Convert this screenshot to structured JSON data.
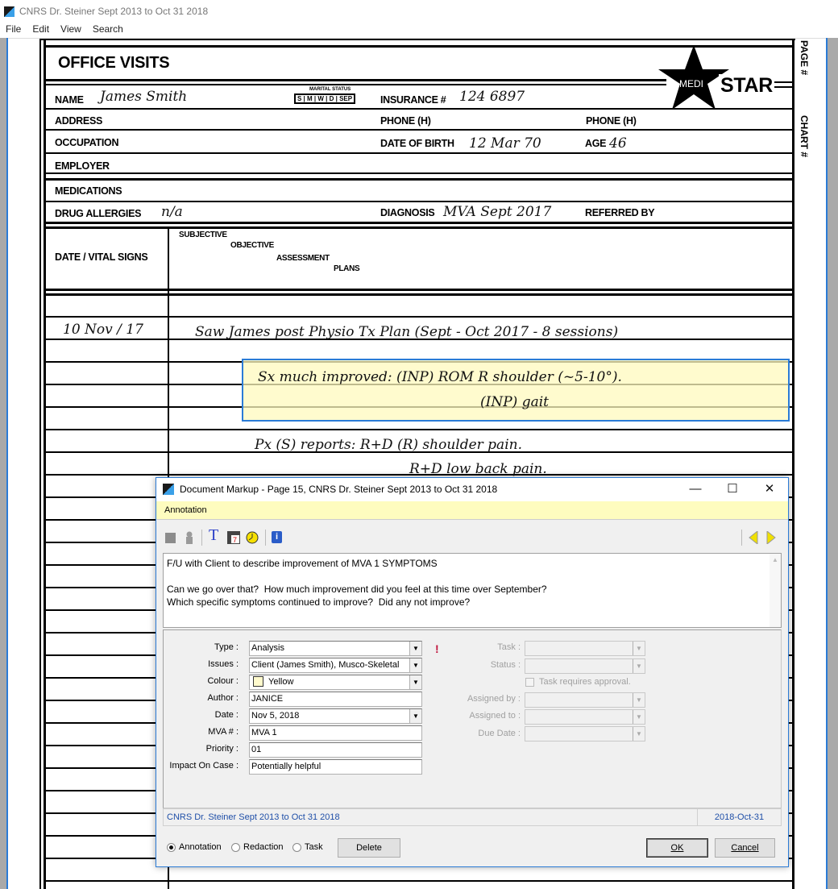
{
  "app": {
    "title": "CNRS Dr. Steiner Sept 2013 to Oct 31 2018",
    "menu": [
      "File",
      "Edit",
      "View",
      "Search"
    ]
  },
  "form": {
    "title": "OFFICE VISITS",
    "logo": "MEDI STAR",
    "logo_medi": "MEDI",
    "logo_star": "STAR",
    "side_labels": [
      "PAGE #",
      "CHART #"
    ],
    "labels": {
      "name": "NAME",
      "marital": "MARITAL STATUS",
      "marital_opts": "S | M | W | D | SEP",
      "insurance": "INSURANCE #",
      "address": "ADDRESS",
      "phone_h1": "PHONE (H)",
      "phone_h2": "PHONE (H)",
      "occupation": "OCCUPATION",
      "dob": "DATE OF BIRTH",
      "age": "AGE",
      "employer": "EMPLOYER",
      "medications": "MEDICATIONS",
      "allergies": "DRUG ALLERGIES",
      "diagnosis": "DIAGNOSIS",
      "referred": "REFERRED BY",
      "date_vitals": "DATE  /  VITAL SIGNS",
      "subjective": "SUBJECTIVE",
      "objective": "OBJECTIVE",
      "assessment": "ASSESSMENT",
      "plans": "PLANS"
    },
    "handwriting": {
      "name": "James Smith",
      "insurance": "124 6897",
      "dob": "12 Mar 70",
      "age": "46",
      "allergies": "n/a",
      "diagnosis": "MVA Sept 2017",
      "visit_date": "10 Nov / 17",
      "line1": "Saw James post Physio Tx Plan (Sept - Oct 2017 - 8 sessions)",
      "line2": "Sx much improved: (INP) ROM R shoulder (~5-10°).",
      "line3": "(INP) gait",
      "line4": "Px (S) reports: R+D (R) shoulder pain.",
      "line5": "R+D low back pain."
    }
  },
  "highlight_color": "#fffabe",
  "dialog": {
    "title": "Document Markup - Page 15, CNRS Dr. Steiner Sept 2013 to Oct 31 2018",
    "controls": {
      "min": "—",
      "max": "☐",
      "close": "✕"
    },
    "menu": "Annotation",
    "toolbar": [
      "stop-icon",
      "user-icon",
      "text-icon",
      "calendar-icon",
      "clock-icon",
      "info-icon",
      "prev-icon",
      "next-icon"
    ],
    "note": "F/U with Client to describe improvement of MVA 1 SYMPTOMS\n\nCan we go over that?  How much improvement did you feel at this time over September?\nWhich specific symptoms continued to improve?  Did any not improve?",
    "fields": [
      {
        "label": "Type :",
        "value": "Analysis",
        "dropdown": true
      },
      {
        "label": "Issues :",
        "value": "Client (James Smith), Musco-Skeletal",
        "dropdown": true
      },
      {
        "label": "Colour :",
        "value": "Yellow",
        "dropdown": true,
        "swatch": "#fffacd"
      },
      {
        "label": "Author :",
        "value": "JANICE"
      },
      {
        "label": "Date :",
        "value": "Nov 5, 2018",
        "dropdown": true
      },
      {
        "label": "MVA # :",
        "value": "MVA 1"
      },
      {
        "label": "Priority :",
        "value": "01"
      },
      {
        "label": "Impact On Case :",
        "value": "Potentially helpful"
      }
    ],
    "priority_mark": "!",
    "task_fields": {
      "task": "Task :",
      "status": "Status :",
      "approval": "Task requires approval.",
      "assigned_by": "Assigned by :",
      "assigned_to": "Assigned to :",
      "due_date": "Due Date :"
    },
    "status": {
      "document": "CNRS Dr. Steiner Sept 2013 to Oct 31 2018",
      "date": "2018-Oct-31"
    },
    "modes": [
      {
        "label": "Annotation",
        "selected": true
      },
      {
        "label": "Redaction",
        "selected": false
      },
      {
        "label": "Task",
        "selected": false
      }
    ],
    "buttons": {
      "delete": "Delete",
      "ok": "OK",
      "cancel": "Cancel"
    }
  }
}
